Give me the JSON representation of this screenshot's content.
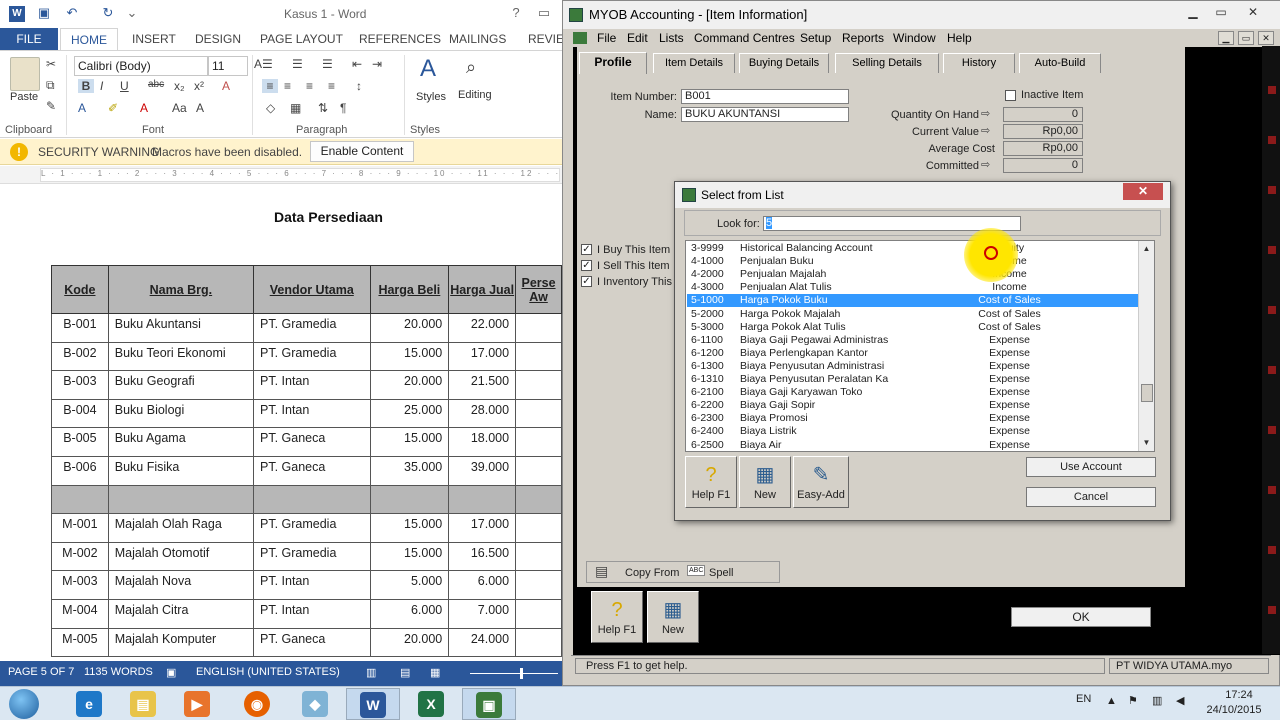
{
  "word": {
    "title": "Kasus 1 - Word",
    "help": "?",
    "tabs": [
      "FILE",
      "HOME",
      "INSERT",
      "DESIGN",
      "PAGE LAYOUT",
      "REFERENCES",
      "MAILINGS",
      "REVIEW"
    ],
    "font_name": "Calibri (Body)",
    "font_size": "11",
    "groups": {
      "clipboard": "Clipboard",
      "font": "Font",
      "paragraph": "Paragraph",
      "styles": "Styles"
    },
    "paste_label": "Paste",
    "styles_label": "Styles",
    "editing_label": "Editing",
    "security": {
      "icon": "!",
      "title": "SECURITY WARNING",
      "message": "Macros have been disabled.",
      "button": "Enable Content"
    },
    "ruler": "L · 1 · · · 1 · · · 2 · · · 3 · · · 4 · · · 5 · · · 6 · · · 7 · · · 8 · · · 9 · · · 10 · · · 11 · · · 12 · · · 13 · · · 14 · · ·",
    "document": {
      "heading": "Data Persediaan",
      "headers": [
        "Kode",
        "Nama Brg.",
        "Vendor Utama",
        "Harga Beli",
        "Harga Jual",
        "Perse Aw"
      ],
      "rows": [
        [
          "B-001",
          "Buku Akuntansi",
          "PT. Gramedia",
          "20.000",
          "22.000"
        ],
        [
          "B-002",
          "Buku Teori Ekonomi",
          "PT. Gramedia",
          "15.000",
          "17.000"
        ],
        [
          "B-003",
          "Buku Geografi",
          "PT. Intan",
          "20.000",
          "21.500"
        ],
        [
          "B-004",
          "Buku Biologi",
          "PT. Intan",
          "25.000",
          "28.000"
        ],
        [
          "B-005",
          "Buku Agama",
          "PT. Ganeca",
          "15.000",
          "18.000"
        ],
        [
          "B-006",
          "Buku Fisika",
          "PT. Ganeca",
          "35.000",
          "39.000"
        ],
        [
          "M-001",
          "Majalah Olah Raga",
          "PT. Gramedia",
          "15.000",
          "17.000"
        ],
        [
          "M-002",
          "Majalah Otomotif",
          "PT. Gramedia",
          "15.000",
          "16.500"
        ],
        [
          "M-003",
          "Majalah Nova",
          "PT. Intan",
          "5.000",
          "6.000"
        ],
        [
          "M-004",
          "Majalah Citra",
          "PT. Intan",
          "6.000",
          "7.000"
        ],
        [
          "M-005",
          "Majalah Komputer",
          "PT. Ganeca",
          "20.000",
          "24.000"
        ]
      ]
    },
    "status": {
      "page": "PAGE 5 OF 7",
      "words": "1135 WORDS",
      "language": "ENGLISH (UNITED STATES)"
    }
  },
  "myob": {
    "title": "MYOB Accounting - [Item Information]",
    "menu": [
      "File",
      "Edit",
      "Lists",
      "Command Centres",
      "Setup",
      "Reports",
      "Window",
      "Help"
    ],
    "tabs": [
      "Profile",
      "Item Details",
      "Buying Details",
      "Selling Details",
      "History",
      "Auto-Build"
    ],
    "item_number_label": "Item Number:",
    "item_number": "B001",
    "name_label": "Name:",
    "name": "BUKU AKUNTANSI",
    "inactive_label": "Inactive Item",
    "qty_label": "Quantity On Hand",
    "qty": "0",
    "current_value_label": "Current Value",
    "current_value": "Rp0,00",
    "avg_cost_label": "Average Cost",
    "avg_cost": "Rp0,00",
    "committed_label": "Committed",
    "committed": "0",
    "checkboxes": [
      {
        "label": "I Buy This Item",
        "checked": "✓"
      },
      {
        "label": "I Sell This Item",
        "checked": "✓"
      },
      {
        "label": "I Inventory This It",
        "checked": "✓"
      }
    ],
    "copy_from": "Copy From",
    "spell": "Spell",
    "spell_icon": "ABC",
    "help_label": "Help F1",
    "new_label": "New",
    "ok_label": "OK",
    "status_hint": "Press F1 to get help.",
    "company_file": "PT WIDYA UTAMA.myo"
  },
  "dialog": {
    "title": "Select from List",
    "close": "✕",
    "look_for_label": "Look for:",
    "look_for_value": "5",
    "accounts": [
      [
        "3-9999",
        "Historical Balancing Account",
        "Equity"
      ],
      [
        "4-1000",
        "Penjualan Buku",
        "Income"
      ],
      [
        "4-2000",
        "Penjualan Majalah",
        "Income"
      ],
      [
        "4-3000",
        "Penjualan Alat Tulis",
        "Income"
      ],
      [
        "5-1000",
        "Harga Pokok Buku",
        "Cost of Sales"
      ],
      [
        "5-2000",
        "Harga Pokok Majalah",
        "Cost of Sales"
      ],
      [
        "5-3000",
        "Harga Pokok Alat Tulis",
        "Cost of Sales"
      ],
      [
        "6-1100",
        "Biaya Gaji Pegawai Administras",
        "Expense"
      ],
      [
        "6-1200",
        "Biaya Perlengkapan Kantor",
        "Expense"
      ],
      [
        "6-1300",
        "Biaya Penyusutan Administrasi",
        "Expense"
      ],
      [
        "6-1310",
        "Biaya Penyusutan Peralatan Ka",
        "Expense"
      ],
      [
        "6-2100",
        "Biaya Gaji Karyawan Toko",
        "Expense"
      ],
      [
        "6-2200",
        "Biaya Gaji Sopir",
        "Expense"
      ],
      [
        "6-2300",
        "Biaya Promosi",
        "Expense"
      ],
      [
        "6-2400",
        "Biaya Listrik",
        "Expense"
      ],
      [
        "6-2500",
        "Biaya Air",
        "Expense"
      ]
    ],
    "selected_index": 4,
    "help_label": "Help F1",
    "new_label": "New",
    "easy_add_label": "Easy-Add",
    "use_account": "Use Account",
    "cancel": "Cancel"
  },
  "taskbar": {
    "lang": "EN",
    "time": "17:24",
    "date": "24/10/2015"
  },
  "colors": {
    "word_blue": "#2b579a",
    "selection": "#3399ff",
    "excel_green": "#217346"
  }
}
